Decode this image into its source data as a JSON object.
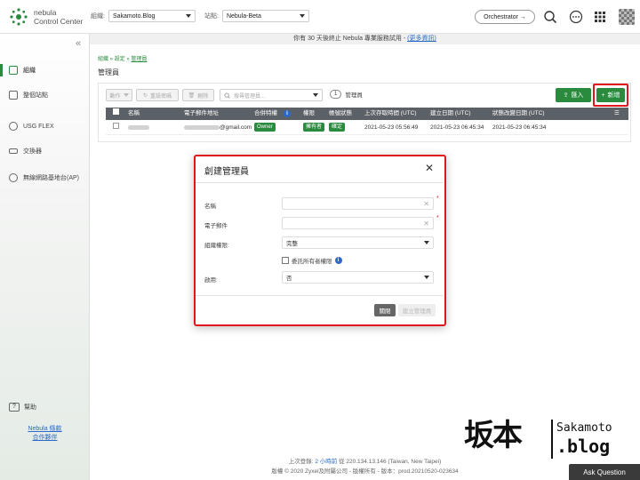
{
  "app": {
    "name_line1": "nebula",
    "name_line2": "Control Center"
  },
  "header": {
    "org_label": "組織:",
    "org_value": "Sakamoto.Blog",
    "site_label": "站點:",
    "site_value": "Nebula-Beta",
    "orchestrator_label": "Orchestrator →"
  },
  "sidebar": {
    "items": [
      {
        "label": "組織"
      },
      {
        "label": "整個站點"
      },
      {
        "label": "USG FLEX"
      },
      {
        "label": "交換器"
      },
      {
        "label": "無線網路基地台(AP)"
      }
    ],
    "help_label": "幫助",
    "link1": "Nebula 條款",
    "link2": "合作夥伴"
  },
  "notice": {
    "text": "你有 30 天後終止 Nebula 專業服務試用 - ",
    "link": "(更多資訊)"
  },
  "breadcrumb": {
    "part1": "組織",
    "sep1": " » ",
    "part2": "設定",
    "sep2": " » ",
    "current": "管理員"
  },
  "page_title": "管理員",
  "toolbar": {
    "action": "動作",
    "reset_password": "重設密碼",
    "delete": "刪除",
    "search_placeholder": "搜尋管理員...",
    "count": "1",
    "count_label": "管理員",
    "import": "匯入",
    "add": "新增"
  },
  "table": {
    "headers": [
      "名稱",
      "電子郵件地址",
      "合併特權",
      "權限",
      "帳號狀態",
      "上次存取時間 (UTC)",
      "建立日期 (UTC)",
      "狀態改變日期 (UTC)"
    ],
    "rows": [
      {
        "email": "@gmail.com",
        "privilege": "Owner",
        "permission": "擁有者",
        "status": "確定",
        "last_access": "2021-05-23 05:56:49",
        "created": "2021-05-23 06:45:34",
        "status_changed": "2021-05-23 06:45:34"
      }
    ]
  },
  "modal": {
    "title": "創建管理員",
    "close": "✕",
    "fields": {
      "name_label": "名稱",
      "email_label": "電子郵件",
      "org_priv_label": "組織權限:",
      "org_priv_value": "完整",
      "delegate_label": "委託所有者權限",
      "enable_label": "啟用:",
      "enable_value": "否"
    },
    "btn_close": "關閉",
    "btn_create": "建立管理員"
  },
  "footer": {
    "line1_prefix": "上次登錄: ",
    "line1_link": "2 小時前",
    "line1_suffix": " 從 220.134.13.146 (Taiwan, New Taipei)",
    "line2": "版權 © 2020 Zyxel及附屬公司 - 版權所有 - 版本：prod.20210520-023634"
  },
  "watermark": {
    "kanji": "坂本",
    "en1": "Sakamoto",
    "en2": ".blog"
  },
  "ask_question": "Ask Question",
  "colors": {
    "accent_green": "#2a8a3e",
    "highlight_red": "#e0181b",
    "link_blue": "#2a6ac8"
  }
}
